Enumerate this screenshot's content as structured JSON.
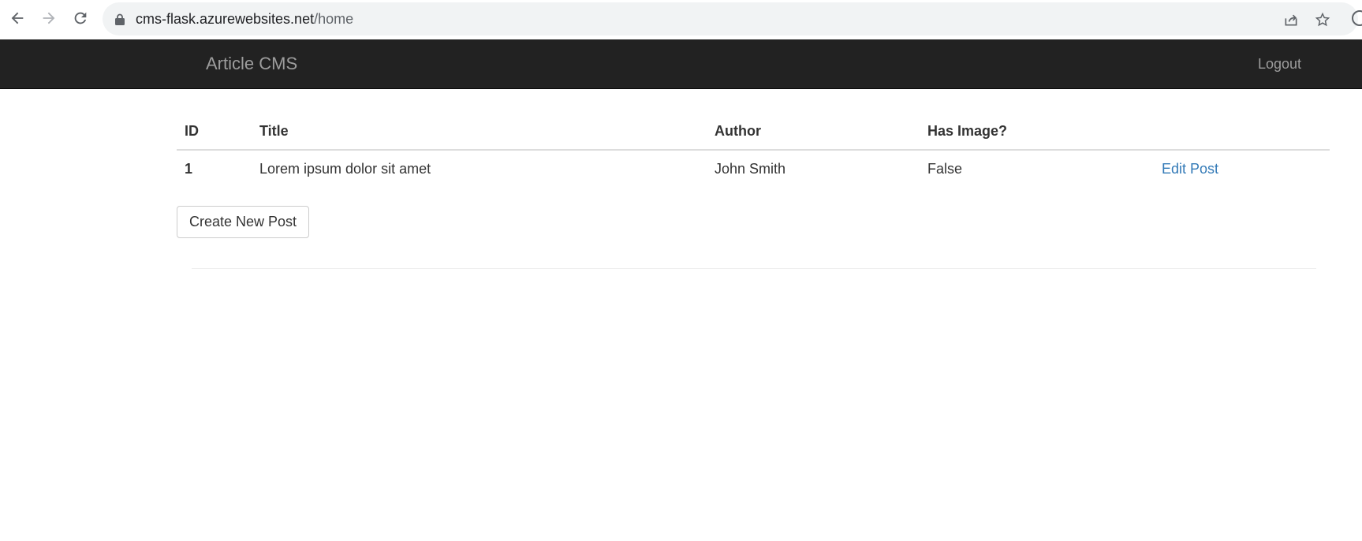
{
  "browser": {
    "url_host": "cms-flask.azurewebsites.net",
    "url_path": "/home"
  },
  "navbar": {
    "brand": "Article CMS",
    "logout": "Logout"
  },
  "table": {
    "headers": [
      "ID",
      "Title",
      "Author",
      "Has Image?",
      ""
    ],
    "rows": [
      {
        "id": "1",
        "title": "Lorem ipsum dolor sit amet",
        "author": "John Smith",
        "has_image": "False",
        "action": "Edit Post"
      }
    ]
  },
  "actions": {
    "create_label": "Create New Post"
  },
  "colors": {
    "navbar_bg": "#222222",
    "navbar_text": "#9d9d9d",
    "link": "#337ab7"
  }
}
